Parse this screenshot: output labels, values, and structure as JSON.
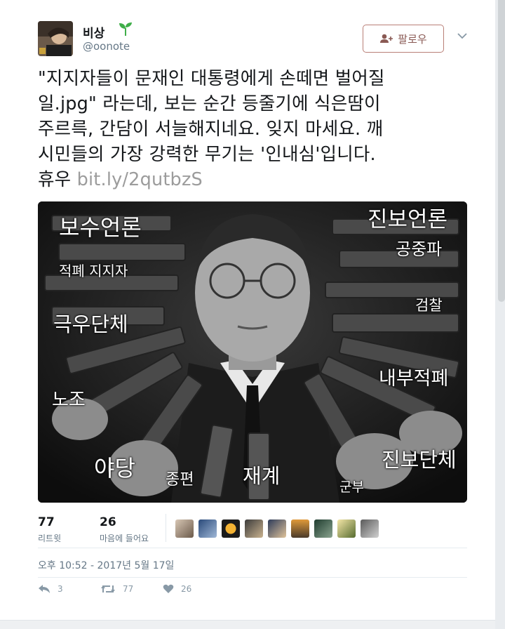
{
  "author": {
    "display_name": "비상",
    "username": "@oonote"
  },
  "follow_button": {
    "label": "팔로우"
  },
  "tweet": {
    "text_lines": [
      "\"지지자들이 문재인 대통령에게 손떼면 벌어질",
      "일.jpg\" 라는데, 보는 순간 등줄기에 식은땀이",
      "주르륵, 간담이 서늘해지네요. 잊지 마세요. 깨",
      "시민들의 가장 강력한 무기는 '인내심'입니다.",
      "휴우 "
    ],
    "link": "bit.ly/2qutbzS"
  },
  "image_labels": {
    "conservative_media": "보수언론",
    "progressive_media": "진보언론",
    "public_broadcast": "공중파",
    "old_supporters": "적폐 지지자",
    "prosecution": "검찰",
    "far_right": "극우단체",
    "internal": "내부적폐",
    "union": "노조",
    "progressive_groups": "진보단체",
    "opposition": "야당",
    "cable": "종편",
    "business": "재계",
    "military": "군부"
  },
  "stats": {
    "retweets_value": "77",
    "retweets_label": "리트윗",
    "likes_value": "26",
    "likes_label": "마음에 들어요"
  },
  "timestamp": "오후 10:52 - 2017년 5월 17일",
  "actions": {
    "reply_count": "3",
    "retweet_count": "77",
    "like_count": "26"
  },
  "colors": {
    "link": "#9c9c9c",
    "follow_border": "#b97f77",
    "meta": "#657786"
  }
}
